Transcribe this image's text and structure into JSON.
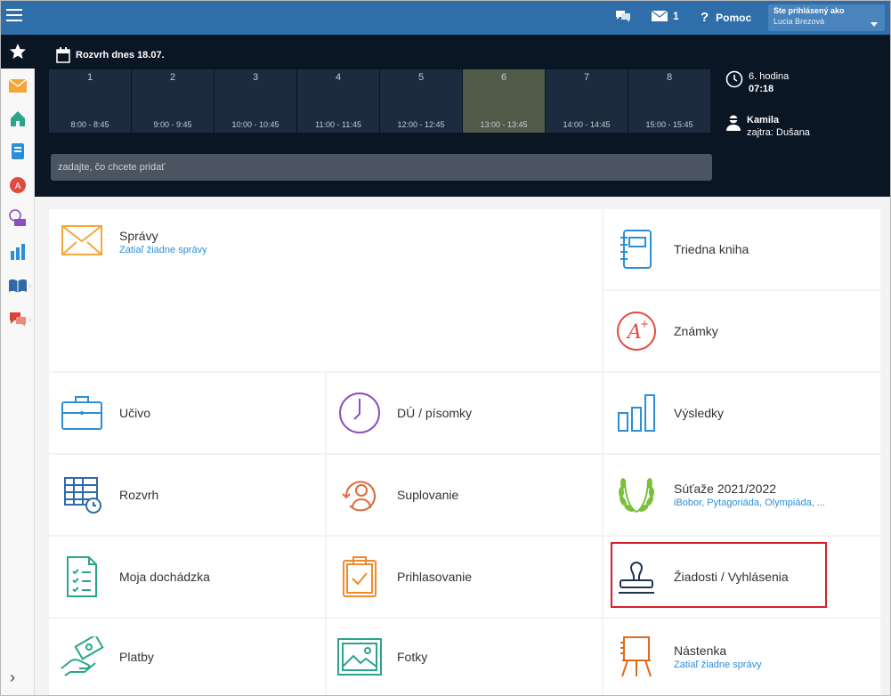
{
  "topbar": {
    "messages_count": "1",
    "help_label": "Pomoc",
    "user_caption": "Ste prihlásený ako",
    "user_name": "Lucia Brezová"
  },
  "schedule": {
    "title": "Rozvrh dnes 18.07.",
    "periods": [
      {
        "num": "1",
        "time": "8:00 - 8:45"
      },
      {
        "num": "2",
        "time": "9:00 - 9:45"
      },
      {
        "num": "3",
        "time": "10:00 - 10:45"
      },
      {
        "num": "4",
        "time": "11:00 - 11:45"
      },
      {
        "num": "5",
        "time": "12:00 - 12:45"
      },
      {
        "num": "6",
        "time": "13:00 - 13:45"
      },
      {
        "num": "7",
        "time": "14:00 - 14:45"
      },
      {
        "num": "8",
        "time": "15:00 - 15:45"
      }
    ],
    "input_placeholder": "zadajte, čo chcete pridať",
    "current_period": "6. hodina",
    "current_time": "07:18",
    "teacher_today": "Kamila",
    "teacher_tomorrow": "zajtra: Dušana"
  },
  "tiles": {
    "spravy": {
      "label": "Správy",
      "sub": "Zatiaľ žiadne správy"
    },
    "triedna_kniha": {
      "label": "Triedna kniha"
    },
    "znamky": {
      "label": "Známky"
    },
    "ucivo": {
      "label": "Učivo"
    },
    "du": {
      "label": "DÚ / písomky"
    },
    "vysledky": {
      "label": "Výsledky"
    },
    "rozvrh": {
      "label": "Rozvrh"
    },
    "suplovanie": {
      "label": "Suplovanie"
    },
    "sutaze": {
      "label": "Súťaže 2021/2022",
      "sub": "iBobor, Pytagoriáda, Olympiáda, ..."
    },
    "dochadzka": {
      "label": "Moja dochádzka"
    },
    "prihlasovanie": {
      "label": "Prihlasovanie"
    },
    "ziadosti": {
      "label": "Žiadosti / Vyhlásenia"
    },
    "platby": {
      "label": "Platby"
    },
    "fotky": {
      "label": "Fotky"
    },
    "nastenka": {
      "label": "Nástenka",
      "sub": "Zatiaľ žiadne správy"
    }
  },
  "colors": {
    "topbar": "#2f6ea9",
    "schedule_bg": "#0b1625",
    "active_period": "#4f5b48",
    "link": "#2b8fd8",
    "highlight": "#d4202a"
  }
}
